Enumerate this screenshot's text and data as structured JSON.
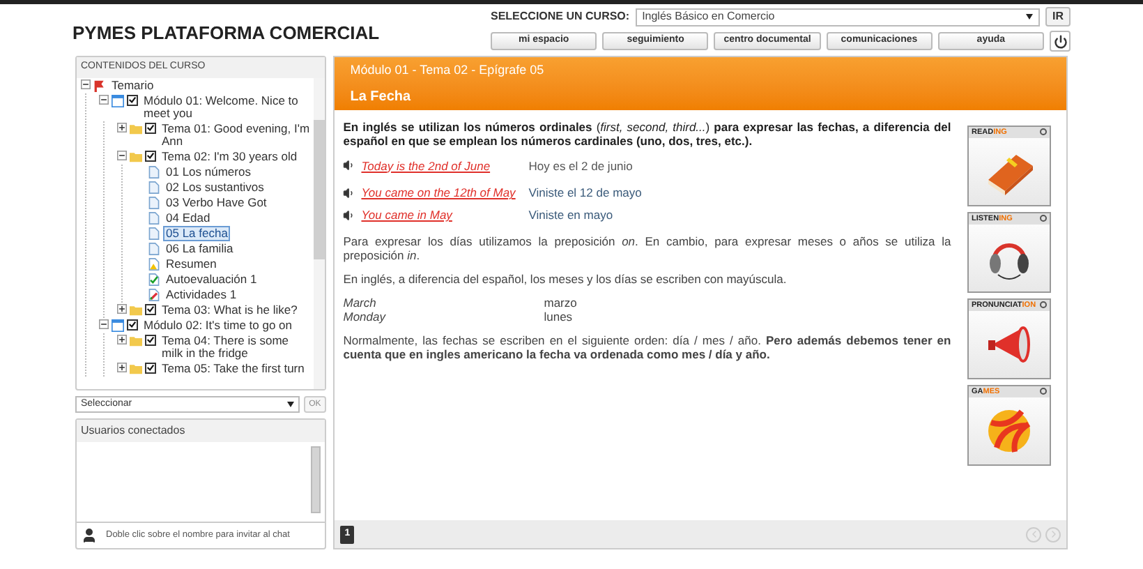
{
  "header": {
    "title": "PYMES PLATAFORMA COMERCIAL",
    "course_label": "SELECCIONE UN CURSO:",
    "course_value": "Inglés Básico en Comercio",
    "go_button": "IR",
    "nav": [
      "mi espacio",
      "seguimiento",
      "centro documental",
      "comunicaciones",
      "ayuda"
    ]
  },
  "sidebar": {
    "title": "CONTENIDOS DEL CURSO",
    "tree": [
      {
        "label": "Temario",
        "kind": "root",
        "expanded": true,
        "children": [
          {
            "label": "Módulo 01: Welcome. Nice to meet you",
            "kind": "module",
            "checked": true,
            "expanded": true,
            "children": [
              {
                "label": "Tema 01: Good evening, I'm Ann",
                "kind": "topic",
                "checked": true,
                "expanded": false
              },
              {
                "label": "Tema 02: I'm 30 years old",
                "kind": "topic",
                "checked": true,
                "expanded": true,
                "children": [
                  {
                    "label": "01 Los números",
                    "kind": "page",
                    "selected": false
                  },
                  {
                    "label": "02 Los sustantivos",
                    "kind": "page",
                    "selected": false
                  },
                  {
                    "label": "03 Verbo Have Got",
                    "kind": "page",
                    "selected": false
                  },
                  {
                    "label": "04 Edad",
                    "kind": "page",
                    "selected": false
                  },
                  {
                    "label": "05 La fecha",
                    "kind": "page",
                    "selected": true
                  },
                  {
                    "label": "06 La familia",
                    "kind": "page",
                    "selected": false
                  },
                  {
                    "label": "Resumen",
                    "kind": "summary",
                    "selected": false
                  },
                  {
                    "label": "Autoevaluación 1",
                    "kind": "test",
                    "selected": false
                  },
                  {
                    "label": "Actividades 1",
                    "kind": "activity",
                    "selected": false
                  }
                ]
              },
              {
                "label": "Tema 03: What is he like?",
                "kind": "topic",
                "checked": true,
                "expanded": false
              }
            ]
          },
          {
            "label": "Módulo 02: It's time to go on",
            "kind": "module",
            "checked": true,
            "expanded": true,
            "children": [
              {
                "label": "Tema 04: There is some milk in the fridge",
                "kind": "topic",
                "checked": true,
                "expanded": false
              },
              {
                "label": "Tema 05: Take the first turn",
                "kind": "topic",
                "checked": true,
                "expanded": false
              }
            ]
          }
        ]
      }
    ],
    "select": "Seleccionar",
    "ok_button": "OK",
    "ok_disabled": true
  },
  "users": {
    "title": "Usuarios conectados",
    "hint": "Doble clic sobre el nombre para invitar al chat"
  },
  "lesson": {
    "breadcrumb": "Módulo 01 - Tema 02 - Epígrafe 05",
    "title": "La Fecha",
    "intro": "**En inglés se utilizan los números ordinales** (*first, second, third...*) **para expresar las fechas, a diferencia del español en que se emplean los números cardinales (uno, dos, tres, etc.).**",
    "example_groups": [
      [
        {
          "english": "Today is the 2nd of June",
          "spanish": "Hoy es el 2 de junio",
          "color": "#555555"
        }
      ],
      [
        {
          "english": "You came on the 12th of May",
          "spanish": "Viniste el 12 de mayo",
          "color": "#3a5a7a"
        },
        {
          "english": "You came in May",
          "spanish": "Viniste en mayo",
          "color": "#3a5a7a"
        }
      ]
    ],
    "para2": "Para expresar los días utilizamos la preposición *on*. En cambio, para expresar meses o años se utiliza la preposición *in*.",
    "para3": "En inglés, a diferencia del español, los meses y los días se escriben con mayúscula.",
    "words": [
      {
        "english": "March",
        "spanish": "marzo"
      },
      {
        "english": "Monday",
        "spanish": "lunes"
      }
    ],
    "para4": "Normalmente, las fechas se escriben en el siguiente orden: día / mes / año. **Pero además debemos tener en cuenta que en ingles americano la fecha va ordenada como mes / día y año.**",
    "skills": [
      {
        "kind": "reading",
        "prefix": "READ",
        "suffix": "ING"
      },
      {
        "kind": "listening",
        "prefix": "LISTEN",
        "suffix": "ING"
      },
      {
        "kind": "pronunciation",
        "prefix": "PRONUNCIAT",
        "suffix": "ION"
      },
      {
        "kind": "games",
        "prefix": "GA",
        "suffix": "MES"
      }
    ],
    "pages": [
      {
        "label": "1",
        "selected": true
      }
    ],
    "prev_disabled": true,
    "next_disabled": true
  }
}
